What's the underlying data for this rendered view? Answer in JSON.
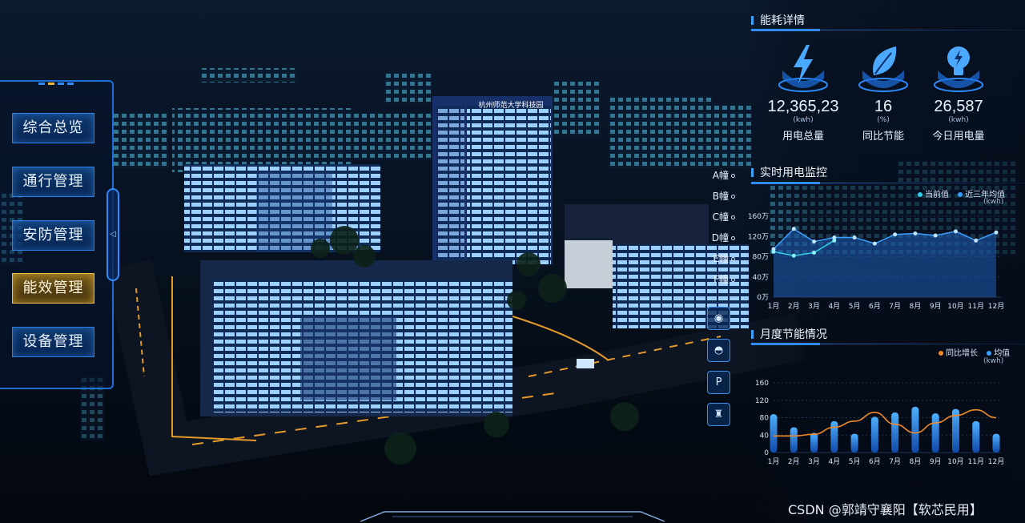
{
  "nav": {
    "items": [
      {
        "label": "综合总览",
        "active": false
      },
      {
        "label": "通行管理",
        "active": false
      },
      {
        "label": "安防管理",
        "active": false
      },
      {
        "label": "能效管理",
        "active": true
      },
      {
        "label": "设备管理",
        "active": false
      }
    ],
    "collapse_glyph": "◁"
  },
  "scene": {
    "building_sign": "杭州师范大学科技园"
  },
  "floors": [
    "A幢",
    "B幢",
    "C幢",
    "D幢",
    "E幢",
    "F幢"
  ],
  "tools": [
    {
      "icon": "camera-icon",
      "glyph": "◉"
    },
    {
      "icon": "dome-camera-icon",
      "glyph": "◓"
    },
    {
      "icon": "parking-icon",
      "glyph": "P"
    },
    {
      "icon": "hydrant-icon",
      "glyph": "♜"
    }
  ],
  "energy_detail": {
    "title": "能耗详情",
    "stats": [
      {
        "value": "12,365,23",
        "unit": "(kwh)",
        "label": "用电总量",
        "icon": "lightning-icon"
      },
      {
        "value": "16",
        "unit": "(%)",
        "label": "同比节能",
        "icon": "leaf-icon"
      },
      {
        "value": "26,587",
        "unit": "(kwh)",
        "label": "今日用电量",
        "icon": "bulb-icon"
      }
    ]
  },
  "realtime": {
    "title": "实时用电监控",
    "legend": [
      "当前值",
      "近三年均值"
    ],
    "unit": "(kwh)"
  },
  "monthly": {
    "title": "月度节能情况",
    "legend": [
      "同比增长",
      "均值"
    ],
    "unit": "(kwh)"
  },
  "watermark": "CSDN @郭靖守襄阳【软芯民用】",
  "colors": {
    "accent": "#2f8cff",
    "active": "#f1bf45",
    "line_current": "#2fd0e8",
    "line_avg": "#3aa0ff",
    "growth": "#f08a2a"
  },
  "chart_data": [
    {
      "type": "area",
      "title": "实时用电监控",
      "categories": [
        "1月",
        "2月",
        "3月",
        "4月",
        "5月",
        "6月",
        "7月",
        "8月",
        "9月",
        "10月",
        "11月",
        "12月"
      ],
      "y_ticks": [
        "160万",
        "120万",
        "80万",
        "40万",
        "0万"
      ],
      "ylim": [
        0,
        160
      ],
      "series": [
        {
          "name": "当前值",
          "values": [
            90,
            82,
            88,
            112,
            null,
            null,
            null,
            null,
            null,
            null,
            null,
            null
          ]
        },
        {
          "name": "近三年均值",
          "values": [
            95,
            135,
            110,
            118,
            118,
            106,
            124,
            126,
            122,
            130,
            112,
            128
          ]
        }
      ]
    },
    {
      "type": "bar",
      "title": "月度节能情况",
      "categories": [
        "1月",
        "2月",
        "3月",
        "4月",
        "5月",
        "6月",
        "7月",
        "8月",
        "9月",
        "10月",
        "11月",
        "12月"
      ],
      "y_ticks": [
        "160",
        "120",
        "80",
        "40",
        "0"
      ],
      "ylim": [
        0,
        160
      ],
      "series": [
        {
          "name": "均值",
          "values": [
            88,
            58,
            45,
            72,
            43,
            82,
            92,
            105,
            90,
            100,
            72,
            43
          ]
        },
        {
          "name": "同比增长",
          "values": [
            38,
            38,
            42,
            58,
            72,
            92,
            65,
            45,
            68,
            85,
            98,
            80
          ]
        }
      ]
    }
  ]
}
